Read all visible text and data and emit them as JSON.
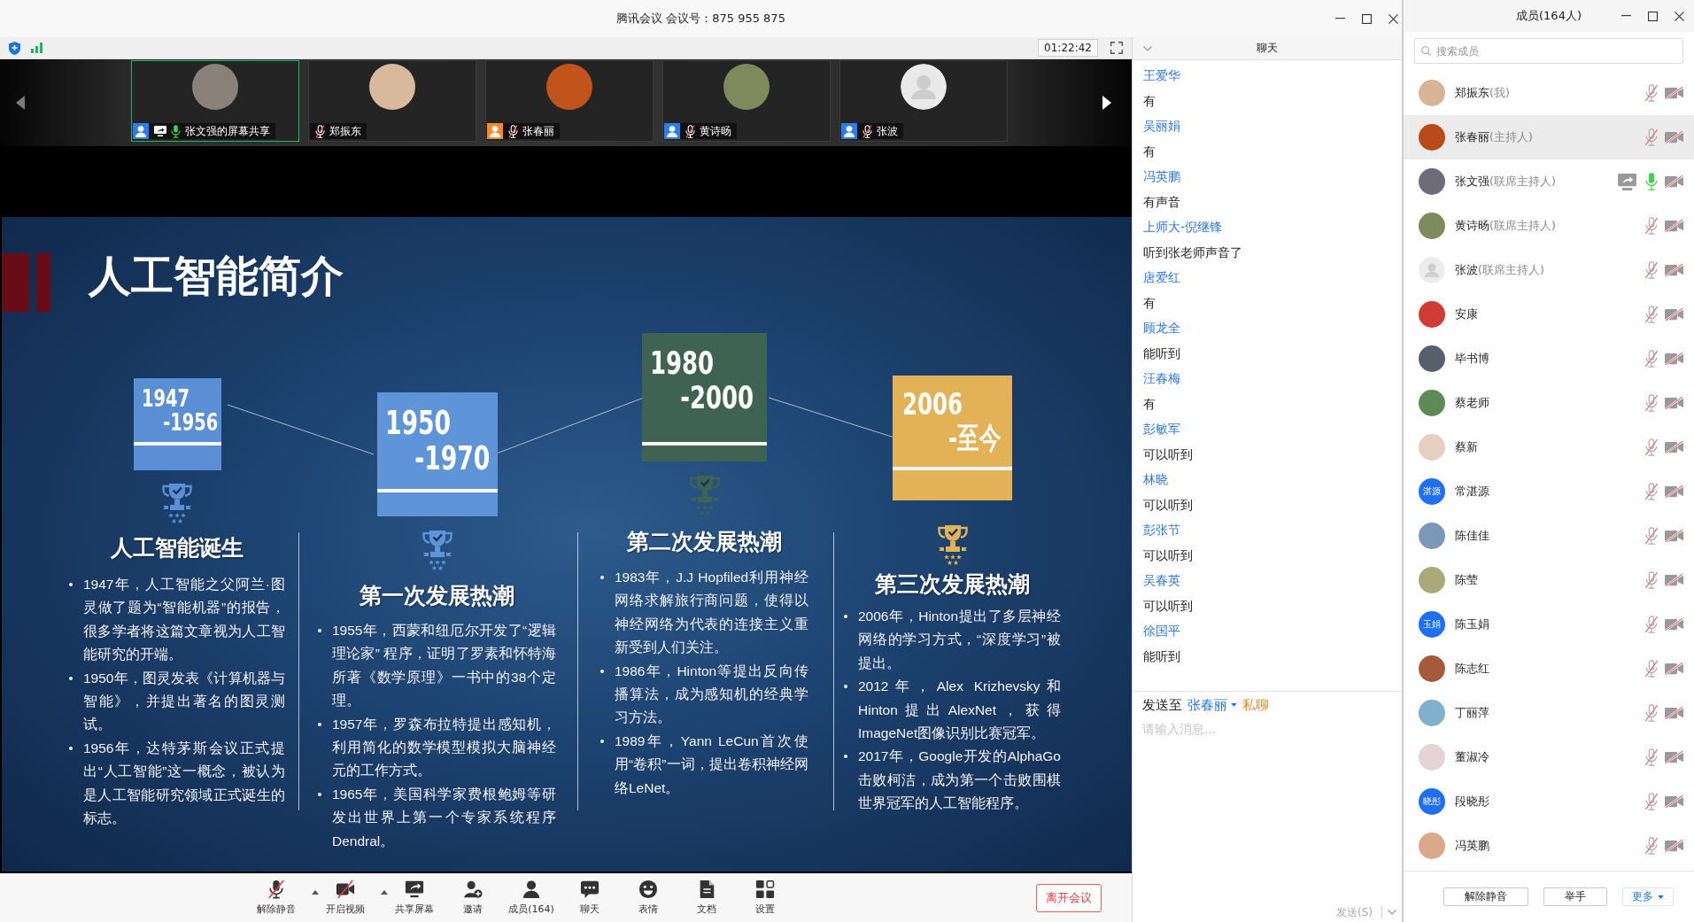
{
  "window": {
    "title": "腾讯会议 会议号：875 955 875"
  },
  "top_bar": {
    "timer": "01:22:42"
  },
  "video_strip": {
    "tiles": [
      {
        "name": "张文强的屏幕共享",
        "avatar": {
          "kind": "photo",
          "color": "#8a8178"
        },
        "badge": {
          "color": "#2b7cf3"
        },
        "sharing": true,
        "mic_on": true,
        "highlighted": true
      },
      {
        "name": "郑振东",
        "avatar": {
          "kind": "photo",
          "color": "#d9b99c"
        },
        "sharing": false,
        "mic_on": false,
        "highlighted": false
      },
      {
        "name": "张春丽",
        "avatar": {
          "kind": "photo",
          "color": "#c2531b"
        },
        "badge": {
          "color": "#f7892b"
        },
        "sharing": false,
        "mic_on": false,
        "highlighted": false
      },
      {
        "name": "黄诗旸",
        "avatar": {
          "kind": "photo",
          "color": "#7e8a5b"
        },
        "badge": {
          "color": "#2b7cf3"
        },
        "sharing": false,
        "mic_on": false,
        "highlighted": false
      },
      {
        "name": "张波",
        "avatar": {
          "kind": "default"
        },
        "badge": {
          "color": "#2b7cf3"
        },
        "sharing": false,
        "mic_on": false,
        "highlighted": false
      }
    ]
  },
  "slide": {
    "title": "人工智能简介",
    "periods": [
      {
        "start": "1947",
        "end": "-1956",
        "color": "#5a8fd6",
        "heading": "人工智能诞生",
        "bullets": [
          "1947年，人工智能之父阿兰·图灵做了题为“智能机器”的报告，很多学者将这篇文章视为人工智能研究的开端。",
          "1950年，图灵发表《计算机器与智能》，并提出著名的图灵测试。",
          "1956年，达特茅斯会议正式提出“人工智能”这一概念，被认为是人工智能研究领域正式诞生的标志。"
        ]
      },
      {
        "start": "1950",
        "end": "-1970",
        "color": "#5e94d8",
        "heading": "第一次发展热潮",
        "bullets": [
          "1955年，西蒙和纽厄尔开发了“逻辑理论家” 程序，证明了罗素和怀特海所著《数学原理》一书中的38个定理。",
          "1957年，罗森布拉特提出感知机，利用简化的数学模型模拟大脑神经元的工作方式。",
          "1965年，美国科学家费根鲍姆等研发出世界上第一个专家系统程序Dendral。"
        ]
      },
      {
        "start": "1980",
        "end": "-2000",
        "color": "#3f6352",
        "heading": "第二次发展热潮",
        "bullets": [
          "1983年，J.J Hopfiled利用神经网络求解旅行商问题，使得以神经网络为代表的连接主义重新受到人们关注。",
          "1986年，Hinton等提出反向传播算法，成为感知机的经典学习方法。",
          "1989年，Yann LeCun首次使用“卷积”一词，提出卷积神经网络LeNet。"
        ]
      },
      {
        "start": "2006",
        "end": "-至今",
        "color": "#e3b256",
        "heading": "第三次发展热潮",
        "bullets": [
          "2006年，Hinton提出了多层神经网络的学习方式，“深度学习”被提出。",
          "2012年，Alex Krizhevsky和Hinton提出AlexNet，获得ImageNet图像识别比赛冠军。",
          "2017年，Google开发的AlphaGo击败柯洁，成为第一个击败围棋世界冠军的人工智能程序。"
        ]
      }
    ]
  },
  "chat": {
    "title": "聊天",
    "messages": [
      {
        "sender": "王爱华",
        "text": "有"
      },
      {
        "sender": "吴丽娟",
        "text": "有"
      },
      {
        "sender": "冯英鹏",
        "text": "有声音"
      },
      {
        "sender": "上师大-倪继锋",
        "text": "听到张老师声音了"
      },
      {
        "sender": "唐爱红",
        "text": "有"
      },
      {
        "sender": "顾龙全",
        "text": "能听到"
      },
      {
        "sender": "汪春梅",
        "text": "有"
      },
      {
        "sender": "彭敏军",
        "text": "可以听到"
      },
      {
        "sender": "林晓",
        "text": "可以听到"
      },
      {
        "sender": "彭张节",
        "text": "可以听到"
      },
      {
        "sender": "吴春英",
        "text": "可以听到"
      },
      {
        "sender": "徐国平",
        "text": "能听到"
      }
    ],
    "send_to": {
      "label": "发送至",
      "recipient": "张春丽",
      "mode": "私聊"
    },
    "input": {
      "placeholder": "请输入消息..."
    },
    "send_button": {
      "label": "发送(S)",
      "disabled": true
    }
  },
  "toolbar": {
    "buttons": [
      {
        "kind": "mic",
        "label": "解除静音",
        "off": true,
        "has_menu": true
      },
      {
        "kind": "camera",
        "label": "开启视频",
        "off": true,
        "has_menu": true
      },
      {
        "kind": "share",
        "label": "共享屏幕",
        "off": false,
        "has_menu": false
      },
      {
        "kind": "invite",
        "label": "邀请",
        "off": false,
        "has_menu": false
      },
      {
        "kind": "members",
        "label": "成员(164)",
        "off": false,
        "has_menu": false
      },
      {
        "kind": "chat",
        "label": "聊天",
        "off": false,
        "has_menu": false
      },
      {
        "kind": "emoji",
        "label": "表情",
        "off": false,
        "has_menu": false
      },
      {
        "kind": "doc",
        "label": "文档",
        "off": false,
        "has_menu": false
      },
      {
        "kind": "settings",
        "label": "设置",
        "off": false,
        "has_menu": false
      }
    ],
    "leave_button": "离开会议"
  },
  "members_panel": {
    "title": "成员(164人)",
    "search": {
      "placeholder": "搜索成员"
    },
    "members": [
      {
        "name": "郑振东",
        "role": "(我)",
        "avatar": {
          "kind": "photo",
          "color": "#d8b496"
        },
        "selected": false,
        "sharing": false,
        "mic_on": false,
        "video_on": false
      },
      {
        "name": "张春丽",
        "role": "(主持人)",
        "avatar": {
          "kind": "photo",
          "color": "#b94b1a"
        },
        "selected": true,
        "sharing": false,
        "mic_on": false,
        "video_on": false
      },
      {
        "name": "张文强",
        "role": "(联席主持人)",
        "avatar": {
          "kind": "photo",
          "color": "#6d6c78"
        },
        "selected": false,
        "sharing": true,
        "mic_on": true,
        "video_on": false
      },
      {
        "name": "黄诗旸",
        "role": "(联席主持人)",
        "avatar": {
          "kind": "photo",
          "color": "#7e8a5b"
        },
        "selected": false,
        "sharing": false,
        "mic_on": false,
        "video_on": false
      },
      {
        "name": "张波",
        "role": "(联席主持人)",
        "avatar": {
          "kind": "default"
        },
        "selected": false,
        "sharing": false,
        "mic_on": false,
        "video_on": false
      },
      {
        "name": "安康",
        "avatar": {
          "kind": "photo",
          "color": "#d23a34"
        },
        "selected": false,
        "sharing": false,
        "mic_on": false,
        "video_on": false
      },
      {
        "name": "毕书博",
        "avatar": {
          "kind": "photo",
          "color": "#57606a"
        },
        "selected": false,
        "sharing": false,
        "mic_on": false,
        "video_on": false
      },
      {
        "name": "蔡老师",
        "avatar": {
          "kind": "photo",
          "color": "#5e8a55"
        },
        "selected": false,
        "sharing": false,
        "mic_on": false,
        "video_on": false
      },
      {
        "name": "蔡新",
        "avatar": {
          "kind": "photo",
          "color": "#e6cfc0"
        },
        "selected": false,
        "sharing": false,
        "mic_on": false,
        "video_on": false
      },
      {
        "name": "常湛源",
        "avatar": {
          "kind": "text",
          "text": "湛源",
          "color": "#1f6ff5"
        },
        "selected": false,
        "sharing": false,
        "mic_on": false,
        "video_on": false
      },
      {
        "name": "陈佳佳",
        "avatar": {
          "kind": "photo",
          "color": "#7b98b8"
        },
        "selected": false,
        "sharing": false,
        "mic_on": false,
        "video_on": false
      },
      {
        "name": "陈莹",
        "avatar": {
          "kind": "photo",
          "color": "#a9a97a"
        },
        "selected": false,
        "sharing": false,
        "mic_on": false,
        "video_on": false
      },
      {
        "name": "陈玉娟",
        "avatar": {
          "kind": "text",
          "text": "玉娟",
          "color": "#1f6ff5"
        },
        "selected": false,
        "sharing": false,
        "mic_on": false,
        "video_on": false
      },
      {
        "name": "陈志红",
        "avatar": {
          "kind": "photo",
          "color": "#a55b3a"
        },
        "selected": false,
        "sharing": false,
        "mic_on": false,
        "video_on": false
      },
      {
        "name": "丁丽萍",
        "avatar": {
          "kind": "photo",
          "color": "#7fb0cc"
        },
        "selected": false,
        "sharing": false,
        "mic_on": false,
        "video_on": false
      },
      {
        "name": "董淑冷",
        "avatar": {
          "kind": "photo",
          "color": "#e5d3d8"
        },
        "selected": false,
        "sharing": false,
        "mic_on": false,
        "video_on": false
      },
      {
        "name": "段晓彤",
        "avatar": {
          "kind": "text",
          "text": "晓彤",
          "color": "#1f6ff5"
        },
        "selected": false,
        "sharing": false,
        "mic_on": false,
        "video_on": false
      },
      {
        "name": "冯英鹏",
        "avatar": {
          "kind": "photo",
          "color": "#d9a98a"
        },
        "selected": false,
        "sharing": false,
        "mic_on": false,
        "video_on": false
      }
    ],
    "buttons": [
      {
        "kind": "plain",
        "label": "解除静音"
      },
      {
        "kind": "plain",
        "label": "举手"
      },
      {
        "kind": "menu",
        "label": "更多"
      }
    ]
  }
}
